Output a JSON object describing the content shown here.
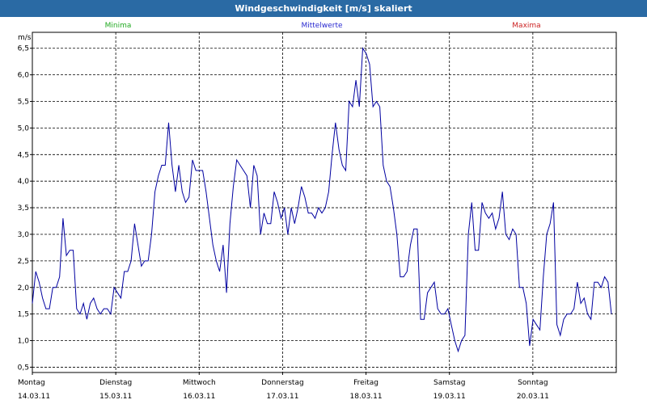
{
  "window": {
    "title": "Windgeschwindigkeit [m/s] skaliert"
  },
  "legend": [
    {
      "label": "Minima",
      "color": "#22aa22"
    },
    {
      "label": "Mittelwerte",
      "color": "#2a2ad0"
    },
    {
      "label": "Maxima",
      "color": "#cc2222"
    }
  ],
  "colors": {
    "line": "#0000a0",
    "title_bar": "#2a6aa4",
    "grid": "#000000"
  },
  "chart_data": {
    "type": "line",
    "title": "Windgeschwindigkeit [m/s] skaliert",
    "ylabel": "m/s",
    "xlabel": "",
    "ylim": [
      0.4,
      6.8
    ],
    "xlim": [
      0,
      7
    ],
    "grid": true,
    "legend_placement": "top",
    "y_ticks": [
      "0,5",
      "1,0",
      "1,5",
      "2,0",
      "2,5",
      "3,0",
      "3,5",
      "4,0",
      "4,5",
      "5,0",
      "5,5",
      "6,0",
      "6,5"
    ],
    "x_ticks": [
      {
        "day": "Montag",
        "date": "14.03.11"
      },
      {
        "day": "Dienstag",
        "date": "15.03.11"
      },
      {
        "day": "Mittwoch",
        "date": "16.03.11"
      },
      {
        "day": "Donnerstag",
        "date": "17.03.11"
      },
      {
        "day": "Freitag",
        "date": "18.03.11"
      },
      {
        "day": "Samstag",
        "date": "19.03.11"
      },
      {
        "day": "Sonntag",
        "date": "20.03.11"
      }
    ],
    "series": [
      {
        "values": [
          1.7,
          2.3,
          2.1,
          1.8,
          1.6,
          1.6,
          2.0,
          2.0,
          2.2,
          3.3,
          2.6,
          2.7,
          2.7,
          1.6,
          1.5,
          1.7,
          1.4,
          1.7,
          1.8,
          1.6,
          1.5,
          1.6,
          1.6,
          1.5,
          2.0,
          1.9,
          1.8,
          2.3,
          2.3,
          2.5,
          3.2,
          2.8,
          2.4,
          2.5,
          2.5,
          3.0,
          3.8,
          4.1,
          4.3,
          4.3,
          5.1,
          4.3,
          3.8,
          4.3,
          3.8,
          3.6,
          3.7,
          4.4,
          4.2,
          4.2,
          4.2,
          3.8,
          3.3,
          2.8,
          2.5,
          2.3,
          2.8,
          1.9,
          3.2,
          3.9,
          4.4,
          4.3,
          4.2,
          4.1,
          3.5,
          4.3,
          4.1,
          3.0,
          3.4,
          3.2,
          3.2,
          3.8,
          3.6,
          3.3,
          3.5,
          3.0,
          3.5,
          3.2,
          3.5,
          3.9,
          3.7,
          3.4,
          3.4,
          3.3,
          3.5,
          3.4,
          3.5,
          3.8,
          4.5,
          5.1,
          4.6,
          4.3,
          4.2,
          5.5,
          5.4,
          5.9,
          5.4,
          6.5,
          6.4,
          6.2,
          5.4,
          5.5,
          5.4,
          4.3,
          4.0,
          3.9,
          3.5,
          3.0,
          2.2,
          2.2,
          2.3,
          2.8,
          3.1,
          3.1,
          1.4,
          1.4,
          1.9,
          2.0,
          2.1,
          1.6,
          1.5,
          1.5,
          1.6,
          1.3,
          1.0,
          0.8,
          1.0,
          1.1,
          3.0,
          3.6,
          2.7,
          2.7,
          3.6,
          3.4,
          3.3,
          3.4,
          3.1,
          3.3,
          3.8,
          3.0,
          2.9,
          3.1,
          3.0,
          2.0,
          2.0,
          1.7,
          0.9,
          1.4,
          1.3,
          1.2,
          2.2,
          3.0,
          3.2,
          3.6,
          1.3,
          1.1,
          1.4,
          1.5,
          1.5,
          1.6,
          2.1,
          1.7,
          1.8,
          1.5,
          1.4,
          2.1,
          2.1,
          2.0,
          2.2,
          2.1,
          1.5
        ]
      }
    ]
  }
}
